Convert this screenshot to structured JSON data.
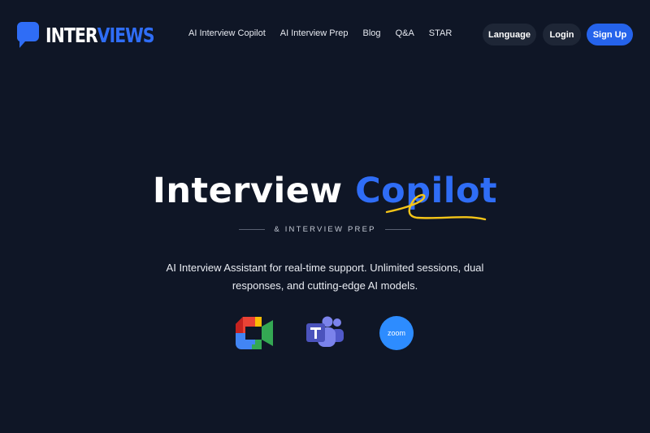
{
  "nav": {
    "logo": {
      "part1": "INTER",
      "part2": "VIEWS"
    },
    "links": [
      "AI Interview Copilot",
      "AI Interview Prep",
      "Blog",
      "Q&A",
      "STAR"
    ],
    "language_label": "Language",
    "login_label": "Login",
    "signup_label": "Sign Up"
  },
  "hero": {
    "title_part1": "Interview",
    "title_part2": "Copilot",
    "subtitle": "& INTERVIEW PREP",
    "description": "AI Interview Assistant for real-time support. Unlimited sessions, dual responses, and cutting-edge AI models."
  },
  "platforms": [
    {
      "icon": "google-meet-icon"
    },
    {
      "icon": "microsoft-teams-icon"
    },
    {
      "icon": "zoom-icon",
      "label": "zoom"
    }
  ],
  "colors": {
    "background": "#0f1626",
    "accent": "#2563eb",
    "highlight": "#f5c518"
  }
}
